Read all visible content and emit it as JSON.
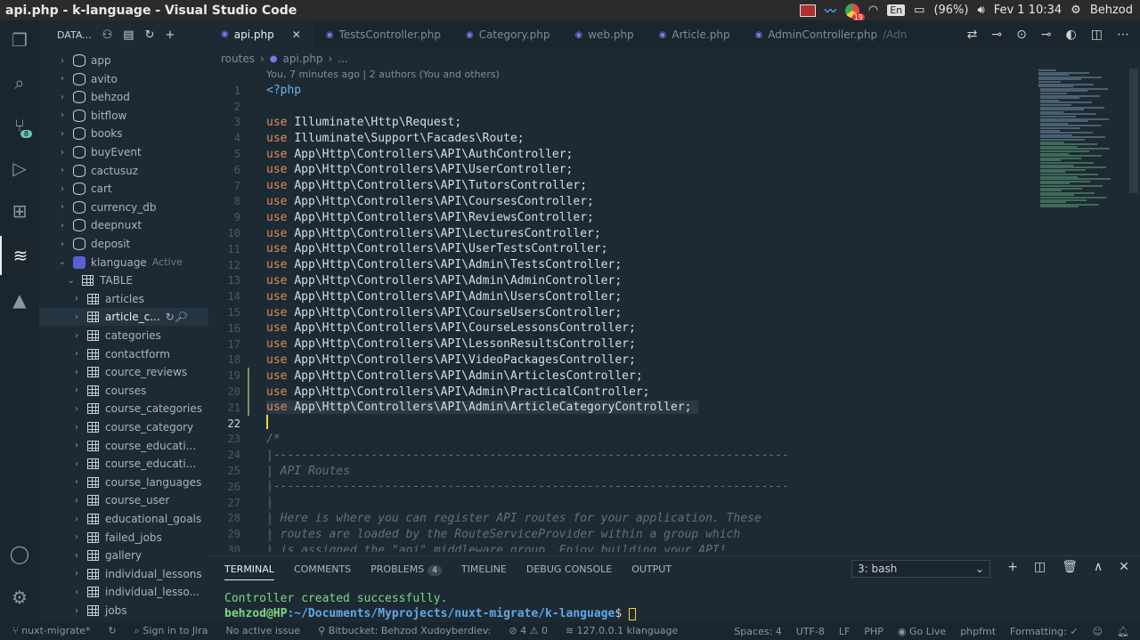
{
  "topbar": {
    "title": "api.php - k-language - Visual Studio Code",
    "lang": "En",
    "battery": "(96%)",
    "datetime": "Fev  1 10:34",
    "user": "Behzod",
    "chrome_badge": "19"
  },
  "activity": {
    "source_control_badge": "8"
  },
  "sidebar": {
    "header": "DATA...",
    "databases": [
      "app",
      "avito",
      "behzod",
      "bitflow",
      "books",
      "buyEvent",
      "cactusuz",
      "cart",
      "currency_db",
      "deepnuxt",
      "deposit"
    ],
    "active_db": "klanguage",
    "active_label": "Active",
    "table_group": "TABLE",
    "tables": [
      "articles",
      "article_c...",
      "categories",
      "contactform",
      "cource_reviews",
      "courses",
      "course_categories",
      "course_category",
      "course_educati...",
      "course_educati...",
      "course_languages",
      "course_user",
      "educational_goals",
      "failed_jobs",
      "gallery",
      "individual_lessons",
      "individual_lesso...",
      "jobs"
    ]
  },
  "tabs": [
    {
      "label": "api.php",
      "active": true
    },
    {
      "label": "TestsController.php",
      "active": false
    },
    {
      "label": "Category.php",
      "active": false
    },
    {
      "label": "web.php",
      "active": false
    },
    {
      "label": "Article.php",
      "active": false
    },
    {
      "label": "AdminController.php",
      "active": false,
      "suffix": "/Adn"
    }
  ],
  "breadcrumb": {
    "folder": "routes",
    "file": "api.php",
    "more": "..."
  },
  "editor": {
    "blame": "You, 7 minutes ago | 2 authors (You and others)",
    "lines": [
      {
        "n": "1",
        "kind": "tag",
        "text": "<?php"
      },
      {
        "n": "2",
        "kind": "blank",
        "text": ""
      },
      {
        "n": "3",
        "kind": "use",
        "text": "Illuminate\\Http\\Request;"
      },
      {
        "n": "4",
        "kind": "use",
        "text": "Illuminate\\Support\\Facades\\Route;"
      },
      {
        "n": "5",
        "kind": "use",
        "text": "App\\Http\\Controllers\\API\\AuthController;"
      },
      {
        "n": "6",
        "kind": "use",
        "text": "App\\Http\\Controllers\\API\\UserController;"
      },
      {
        "n": "7",
        "kind": "use",
        "text": "App\\Http\\Controllers\\API\\TutorsController;"
      },
      {
        "n": "8",
        "kind": "use",
        "text": "App\\Http\\Controllers\\API\\CoursesController;"
      },
      {
        "n": "9",
        "kind": "use",
        "text": "App\\Http\\Controllers\\API\\ReviewsController;"
      },
      {
        "n": "10",
        "kind": "use",
        "text": "App\\Http\\Controllers\\API\\LecturesController;"
      },
      {
        "n": "11",
        "kind": "use",
        "text": "App\\Http\\Controllers\\API\\UserTestsController;"
      },
      {
        "n": "12",
        "kind": "use",
        "text": "App\\Http\\Controllers\\API\\Admin\\TestsController;"
      },
      {
        "n": "13",
        "kind": "use",
        "text": "App\\Http\\Controllers\\API\\Admin\\AdminController;"
      },
      {
        "n": "14",
        "kind": "use",
        "text": "App\\Http\\Controllers\\API\\Admin\\UsersController;"
      },
      {
        "n": "15",
        "kind": "use",
        "text": "App\\Http\\Controllers\\API\\CourseUsersController;"
      },
      {
        "n": "16",
        "kind": "use",
        "text": "App\\Http\\Controllers\\API\\CourseLessonsController;"
      },
      {
        "n": "17",
        "kind": "use",
        "text": "App\\Http\\Controllers\\API\\LessonResultsController;"
      },
      {
        "n": "18",
        "kind": "use",
        "text": "App\\Http\\Controllers\\API\\VideoPackagesController;"
      },
      {
        "n": "19",
        "kind": "use",
        "text": "App\\Http\\Controllers\\API\\Admin\\ArticlesController;",
        "mod": true
      },
      {
        "n": "20",
        "kind": "use",
        "text": "App\\Http\\Controllers\\API\\Admin\\PracticalController;",
        "mod": true
      },
      {
        "n": "21",
        "kind": "use",
        "text": "App\\Http\\Controllers\\API\\Admin\\ArticleCategoryController; ",
        "mod": true,
        "hl": true
      },
      {
        "n": "22",
        "kind": "cursor",
        "text": ""
      },
      {
        "n": "23",
        "kind": "comment",
        "text": "/*"
      },
      {
        "n": "24",
        "kind": "comment",
        "text": "|--------------------------------------------------------------------------"
      },
      {
        "n": "25",
        "kind": "comment",
        "text": "| API Routes"
      },
      {
        "n": "26",
        "kind": "comment",
        "text": "|--------------------------------------------------------------------------"
      },
      {
        "n": "27",
        "kind": "comment",
        "text": "|"
      },
      {
        "n": "28",
        "kind": "comment",
        "text": "| Here is where you can register API routes for your application. These"
      },
      {
        "n": "29",
        "kind": "comment",
        "text": "| routes are loaded by the RouteServiceProvider within a group which"
      },
      {
        "n": "30",
        "kind": "comment",
        "text": "| is assigned the \"api\" middleware group. Enjoy building your API!"
      }
    ],
    "use_keyword": "use"
  },
  "panel": {
    "tabs": [
      "TERMINAL",
      "COMMENTS",
      "PROBLEMS",
      "TIMELINE",
      "DEBUG CONSOLE",
      "OUTPUT"
    ],
    "problems_count": "4",
    "terminal_select": "3: bash",
    "output_line": "Controller created successfully.",
    "prompt_user": "behzod@HP",
    "prompt_path": ":~/Documents/Myprojects/nuxt-migrate/k-language",
    "prompt_symbol": "$ "
  },
  "statusbar": {
    "branch": "nuxt-migrate*",
    "jira": "Sign in to Jira",
    "issue": "No active issue",
    "bitbucket": "Bitbucket: Behzod Xudoyberdiev:",
    "problems": "⊘ 4 ⚠ 0",
    "db": "127.0.0.1  klanguage",
    "spaces": "Spaces: 4",
    "encoding": "UTF-8",
    "eol": "LF",
    "language": "PHP",
    "golive": "Go Live",
    "phpfmt": "phpfmt",
    "formatting": "Formatting: ✓"
  }
}
